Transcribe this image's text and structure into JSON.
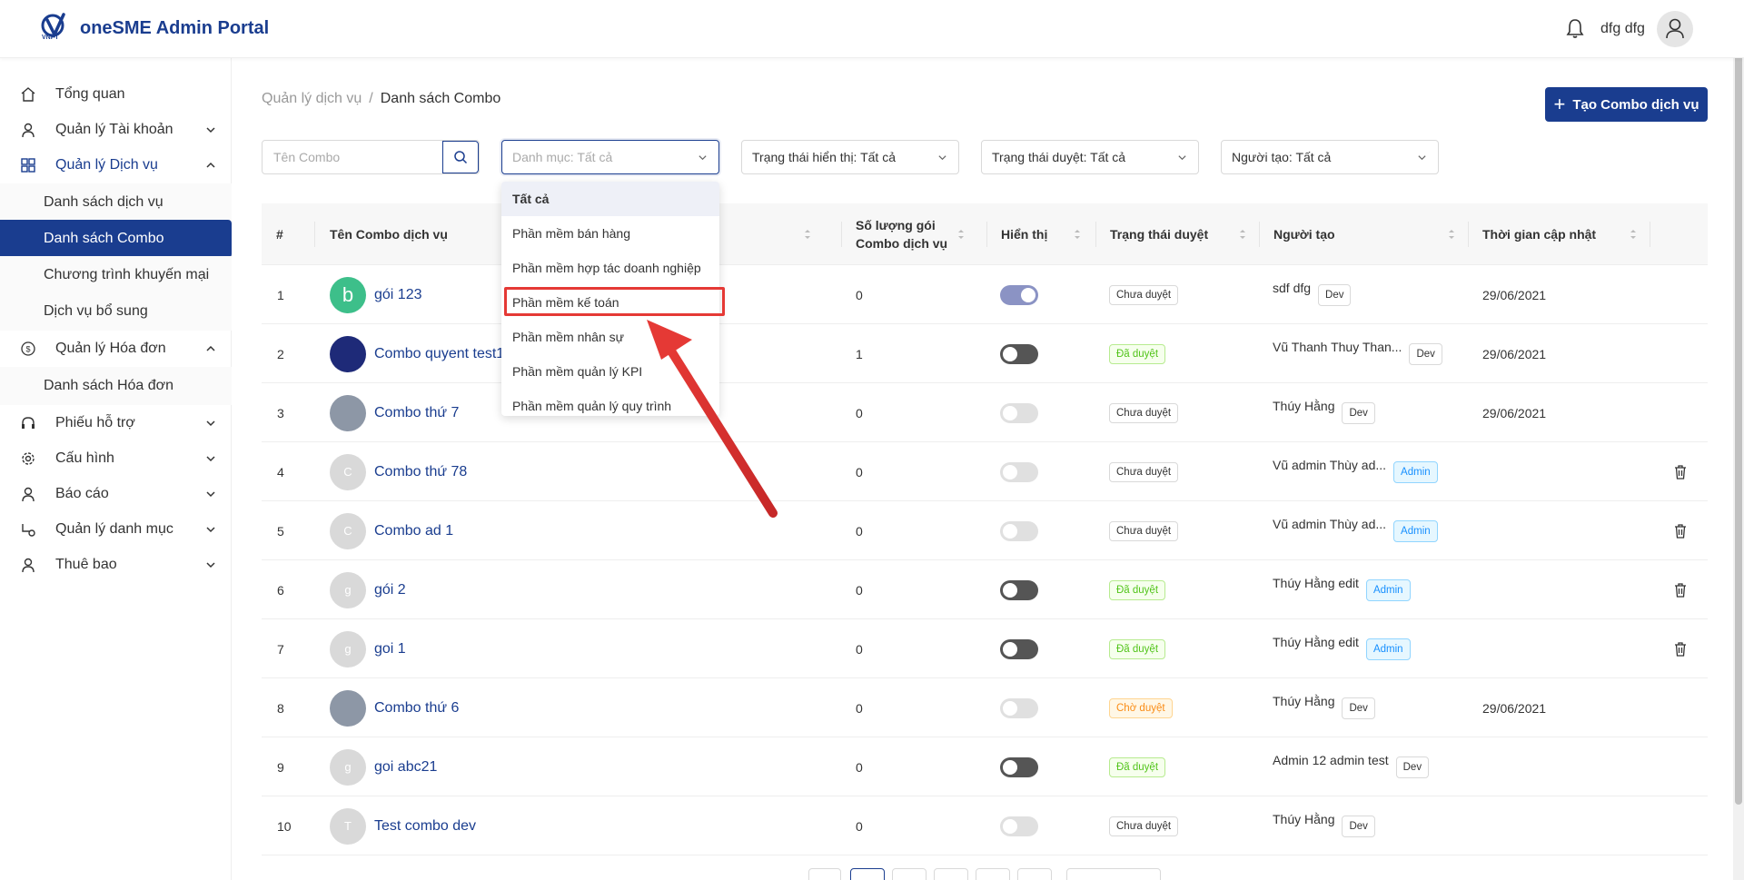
{
  "header": {
    "brand": "oneSME Admin Portal",
    "logo_sub": "VNPT",
    "username": "dfg dfg"
  },
  "sidebar": {
    "items": [
      {
        "label": "Tổng quan",
        "icon": "home-icon"
      },
      {
        "label": "Quản lý Tài khoản",
        "icon": "user-icon"
      },
      {
        "label": "Quản lý Dịch vụ",
        "icon": "grid-icon"
      },
      {
        "label": "Quản lý Hóa đơn",
        "icon": "dollar-icon"
      },
      {
        "label": "Phiếu hỗ trợ",
        "icon": "headset-icon"
      },
      {
        "label": "Cấu hình",
        "icon": "gear-icon"
      },
      {
        "label": "Báo cáo",
        "icon": "user-icon"
      },
      {
        "label": "Quản lý danh mục",
        "icon": "category-icon"
      },
      {
        "label": "Thuê bao",
        "icon": "user-icon"
      }
    ],
    "sub_services": [
      "Danh sách dịch vụ",
      "Danh sách Combo",
      "Chương trình khuyến mại",
      "Dịch vụ bổ sung"
    ],
    "sub_invoice": [
      "Danh sách Hóa đơn"
    ]
  },
  "breadcrumb": {
    "parent": "Quản lý dịch vụ",
    "separator": "/",
    "current": "Danh sách Combo"
  },
  "actions": {
    "create_label": "Tạo Combo dịch vụ"
  },
  "filters": {
    "search_placeholder": "Tên Combo",
    "category": "Danh mục: Tất cả",
    "display_status": "Trạng thái hiển thị: Tất cả",
    "approval_status": "Trạng thái duyệt: Tất cả",
    "creator": "Người tạo: Tất cả"
  },
  "dropdown": {
    "options": [
      "Tất cả",
      "Phần mềm bán hàng",
      "Phần mềm hợp tác doanh nghiệp",
      "Phần mềm kế toán",
      "Phần mềm nhân sự",
      "Phần mềm quản lý KPI",
      "Phần mềm quản lý quy trình"
    ],
    "selected_index": 0,
    "highlighted_index": 3
  },
  "table": {
    "headers": {
      "index": "#",
      "name": "Tên Combo dịch vụ",
      "qty_line1": "Số lượng gói",
      "qty_line2": "Combo dịch vụ",
      "display": "Hiển thị",
      "status": "Trạng thái duyệt",
      "creator": "Người tạo",
      "updated": "Thời gian cập nhật"
    },
    "rows": [
      {
        "idx": "1",
        "name": "gói 123",
        "thumb": "b",
        "qty": "0",
        "display": "on",
        "status": "Chưa duyệt",
        "creator": "sdf dfg",
        "role": "Dev",
        "date": "29/06/2021",
        "deletable": false
      },
      {
        "idx": "2",
        "name": "Combo quyent test1",
        "thumb": "",
        "qty": "1",
        "display": "dark",
        "status": "Đã duyệt",
        "creator": "Vũ Thanh Thuy Than...",
        "role": "Dev",
        "date": "29/06/2021",
        "deletable": false
      },
      {
        "idx": "3",
        "name": "Combo thứ 7",
        "thumb": "",
        "qty": "0",
        "display": "off",
        "status": "Chưa duyệt",
        "creator": "Thúy Hằng",
        "role": "Dev",
        "date": "29/06/2021",
        "deletable": false
      },
      {
        "idx": "4",
        "name": "Combo thứ 78",
        "thumb": "C",
        "qty": "0",
        "display": "off",
        "status": "Chưa duyệt",
        "creator": "Vũ admin Thùy ad...",
        "role": "Admin",
        "date": "",
        "deletable": true
      },
      {
        "idx": "5",
        "name": "Combo ad 1",
        "thumb": "C",
        "qty": "0",
        "display": "off",
        "status": "Chưa duyệt",
        "creator": "Vũ admin Thùy ad...",
        "role": "Admin",
        "date": "",
        "deletable": true
      },
      {
        "idx": "6",
        "name": "gói 2",
        "thumb": "g",
        "qty": "0",
        "display": "dark",
        "status": "Đã duyệt",
        "creator": "Thúy Hằng edit",
        "role": "Admin",
        "date": "",
        "deletable": true
      },
      {
        "idx": "7",
        "name": "goi 1",
        "thumb": "g",
        "qty": "0",
        "display": "dark",
        "status": "Đã duyệt",
        "creator": "Thúy Hằng edit",
        "role": "Admin",
        "date": "",
        "deletable": true
      },
      {
        "idx": "8",
        "name": "Combo thứ 6",
        "thumb": "",
        "qty": "0",
        "display": "off",
        "status": "Chờ duyệt",
        "creator": "Thúy Hằng",
        "role": "Dev",
        "date": "29/06/2021",
        "deletable": false
      },
      {
        "idx": "9",
        "name": "goi abc21",
        "thumb": "g",
        "qty": "0",
        "display": "dark",
        "status": "Đã duyệt",
        "creator": "Admin 12 admin test",
        "role": "Dev",
        "date": "",
        "deletable": false
      },
      {
        "idx": "10",
        "name": "Test combo dev",
        "thumb": "T",
        "qty": "0",
        "display": "off",
        "status": "Chưa duyệt",
        "creator": "Thúy Hằng",
        "role": "Dev",
        "date": "",
        "deletable": false
      }
    ]
  },
  "colors": {
    "primary": "#1a3d8f",
    "approved": "#52c41a",
    "pending": "#fa8c16",
    "admin_role": "#1890ff",
    "annotation": "#e53935"
  }
}
